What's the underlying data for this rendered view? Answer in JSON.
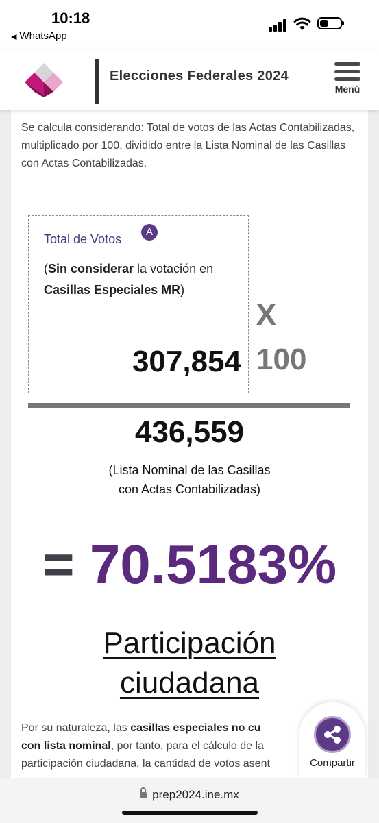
{
  "status_bar": {
    "time": "10:18",
    "back_app": "WhatsApp"
  },
  "header": {
    "title": "Elecciones Federales 2024",
    "menu_label": "Menú",
    "logo_colors": [
      "#c2177a",
      "#8a1059",
      "#e8a6cc",
      "#d0d0d0"
    ]
  },
  "intro_text": "Se calcula considerando: Total de votos de las Actas Contabilizadas, multiplicado por 100, dividido entre la Lista Nominal de las Casillas con Actas Contabilizadas.",
  "formula": {
    "votes_title": "Total de Votos",
    "badge": "A",
    "note_open": "(",
    "note_bold_1": "Sin considerar",
    "note_mid": " la votación en ",
    "note_bold_2": "Casillas Especiales MR",
    "note_close": ")",
    "votes_value": "307,854",
    "multiply_sign": "X",
    "multiplier": "100",
    "denominator": "436,559",
    "denominator_label_1": "(Lista Nominal de las Casillas",
    "denominator_label_2": "con Actas Contabilizadas)",
    "equals": "=",
    "result": "70.5183%"
  },
  "section_title_1": "Participación",
  "section_title_2": "ciudadana",
  "bottom_paragraph": {
    "l1_a": "Por su naturaleza, las ",
    "l1_b": "casillas especiales no cu",
    "l2_a": "con lista nominal",
    "l2_b": ", por tanto, para el cálculo de la",
    "l3": "participación ciudadana, la cantidad de votos asent"
  },
  "share": {
    "label": "Compartir",
    "icon": "share-icon"
  },
  "browser": {
    "url": "prep2024.ine.mx"
  },
  "colors": {
    "accent_purple": "#5b2a7e",
    "result_purple": "#5b2a7e"
  }
}
